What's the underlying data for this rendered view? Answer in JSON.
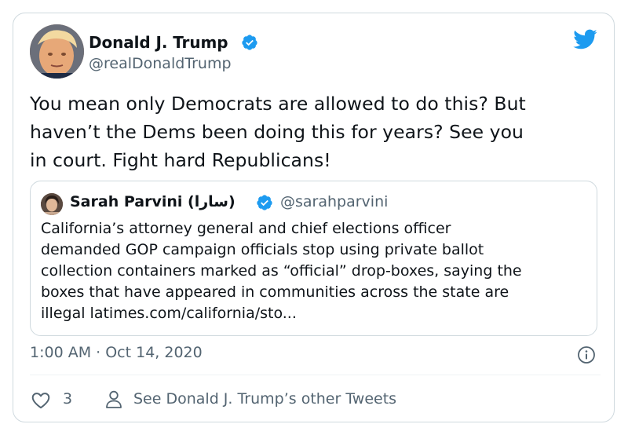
{
  "colors": {
    "verified": "#1d9bf0",
    "twitter_blue": "#1d9bf0",
    "text_primary": "#0f1419",
    "text_secondary": "#536471",
    "border": "#cfd9de"
  },
  "tweet": {
    "author": {
      "name": "Donald J. Trump",
      "handle": "@realDonaldTrump",
      "verified_icon": "verified-badge-icon"
    },
    "text_lines": [
      "You mean only Democrats are allowed to do this? But",
      "haven’t the Dems been doing this for years? See you",
      "in court. Fight hard Republicans!"
    ],
    "timestamp": "1:00 AM · Oct 14, 2020"
  },
  "quoted_tweet": {
    "author": {
      "name": "Sarah Parvini (سارا)",
      "handle": "@sarahparvini"
    },
    "text_lines": [
      "California’s attorney general and chief elections officer",
      "demanded GOP campaign officials stop using private ballot",
      "collection containers marked as “official” drop-boxes, saying the",
      "boxes that have appeared in communities across the state are",
      "illegal latimes.com/california/sto..."
    ]
  },
  "actions": {
    "like_count": "3",
    "other_tweets_label": "See Donald J. Trump’s other Tweets"
  },
  "icons": {
    "brand": "twitter-bird-icon",
    "info": "info-icon",
    "like": "heart-icon",
    "profile": "person-icon"
  }
}
